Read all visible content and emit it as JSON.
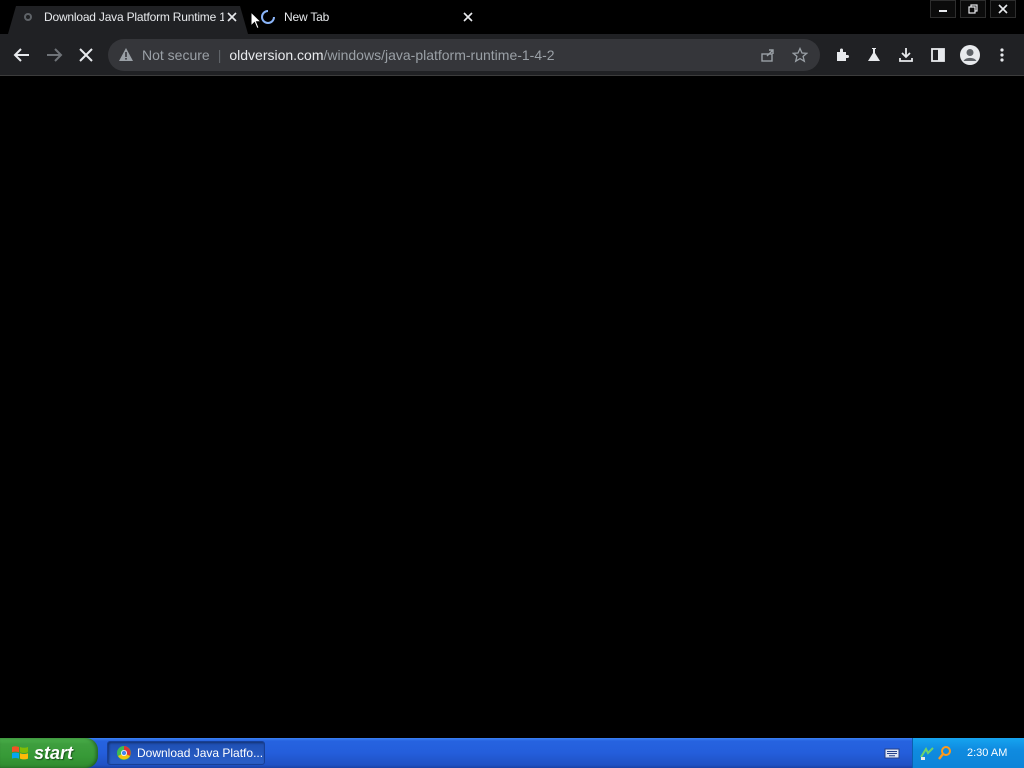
{
  "browser": {
    "tabs": [
      {
        "title": "Download Java Platform Runtime 1",
        "active": true
      },
      {
        "title": "New Tab",
        "active": false,
        "loading": true
      }
    ],
    "address_bar": {
      "security_label": "Not secure",
      "url_host": "oldversion.com",
      "url_path": "/windows/java-platform-runtime-1-4-2"
    },
    "toolbar_icons": [
      "back-icon",
      "forward-icon",
      "stop-icon",
      "share-icon",
      "star-icon",
      "extensions-icon",
      "labs-icon",
      "download-icon",
      "side-panel-icon",
      "profile-icon",
      "menu-icon"
    ]
  },
  "taskbar": {
    "start_label": "start",
    "task_label": "Download Java Platfo...",
    "clock": "2:30 AM"
  },
  "colors": {
    "chrome_toolbar": "#202124",
    "omnibox": "#35363a",
    "xp_taskbar": "#245edb",
    "xp_start": "#3e9e3e",
    "xp_tray": "#0f8be0"
  }
}
